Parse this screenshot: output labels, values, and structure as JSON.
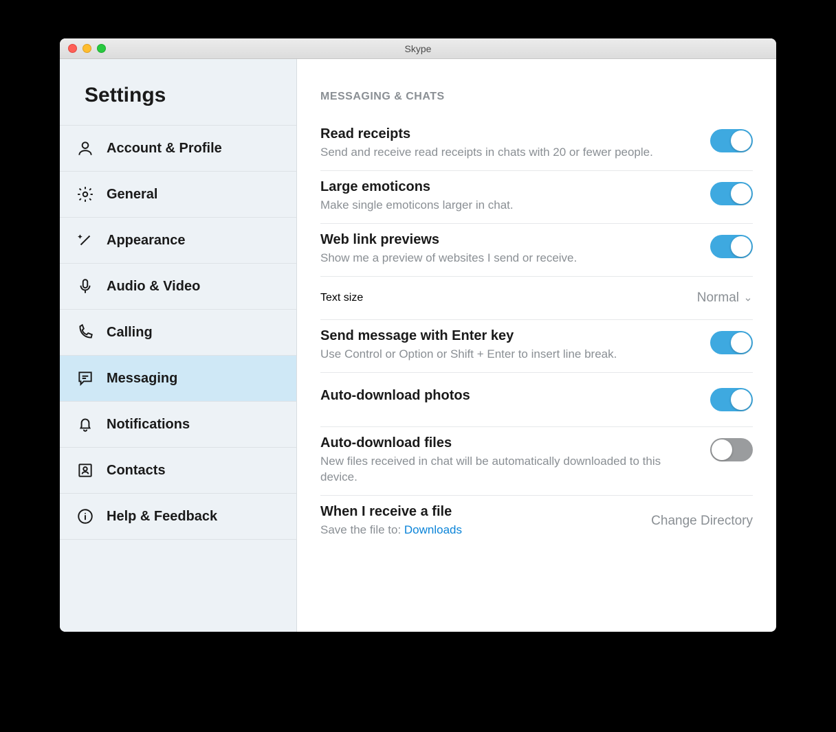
{
  "window": {
    "title": "Skype"
  },
  "sidebar": {
    "heading": "Settings",
    "items": [
      {
        "id": "account",
        "label": "Account & Profile"
      },
      {
        "id": "general",
        "label": "General"
      },
      {
        "id": "appearance",
        "label": "Appearance"
      },
      {
        "id": "audio-video",
        "label": "Audio & Video"
      },
      {
        "id": "calling",
        "label": "Calling"
      },
      {
        "id": "messaging",
        "label": "Messaging",
        "active": true
      },
      {
        "id": "notifications",
        "label": "Notifications"
      },
      {
        "id": "contacts",
        "label": "Contacts"
      },
      {
        "id": "help",
        "label": "Help & Feedback"
      }
    ]
  },
  "content": {
    "section": "MESSAGING & CHATS",
    "rows": {
      "read_receipts": {
        "title": "Read receipts",
        "desc": "Send and receive read receipts in chats with 20 or fewer people.",
        "on": true
      },
      "large_emoticons": {
        "title": "Large emoticons",
        "desc": "Make single emoticons larger in chat.",
        "on": true
      },
      "web_link": {
        "title": "Web link previews",
        "desc": "Show me a preview of websites I send or receive.",
        "on": true
      },
      "text_size": {
        "title": "Text size",
        "value": "Normal"
      },
      "send_enter": {
        "title": "Send message with Enter key",
        "desc": "Use Control or Option or Shift + Enter to insert line break.",
        "on": true
      },
      "auto_photos": {
        "title": "Auto-download photos",
        "on": true
      },
      "auto_files": {
        "title": "Auto-download files",
        "desc": "New files received in chat will be automatically downloaded to this device.",
        "on": false
      },
      "receive_file": {
        "title": "When I receive a file",
        "desc_prefix": "Save the file to: ",
        "link": "Downloads",
        "action": "Change Directory"
      }
    }
  }
}
